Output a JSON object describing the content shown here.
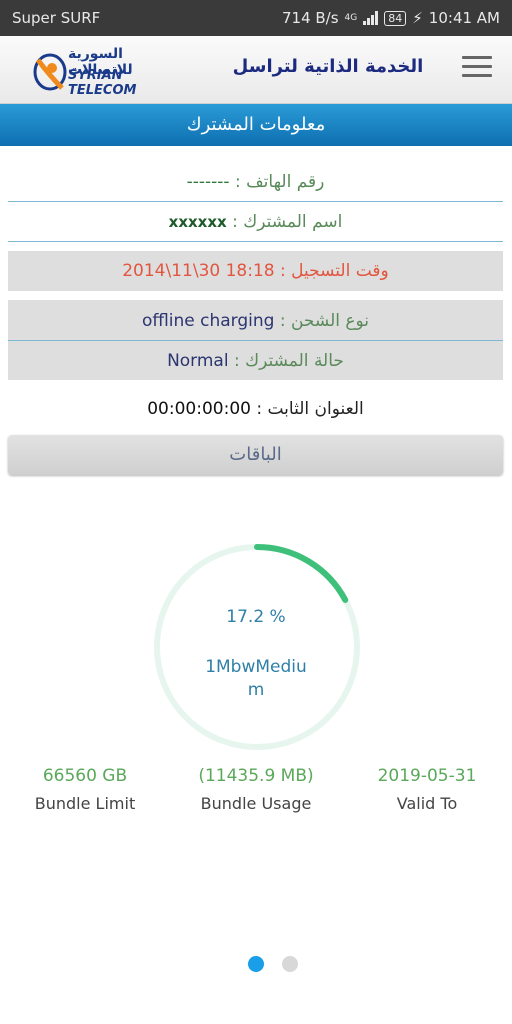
{
  "status_bar": {
    "carrier": "Super SURF",
    "speed": "714 B/s",
    "network": "4G",
    "battery": "84",
    "time": "10:41 AM"
  },
  "app_bar": {
    "logo_arabic": "السورية للاتصالات",
    "logo_english": "SYRIAN TELECOM",
    "title": "الخدمة الذاتية لتراسل"
  },
  "section_title": "معلومات المشترك",
  "subscriber": {
    "phone_label": "رقم الهاتف :",
    "phone_value": "-------",
    "name_label": "اسم المشترك :",
    "name_value": "xxxxxx",
    "reg_label": "وقت التسجيل :",
    "reg_value": "2014\\11\\30 18:18",
    "charge_label": "نوع الشحن :",
    "charge_value": "offline charging",
    "state_label": "حالة المشترك :",
    "state_value": "Normal",
    "ip_label": "العنوان الثابت :",
    "ip_value": "00:00:00:00"
  },
  "packages_button": "الباقات",
  "bundle": {
    "percent_text": "17.2 %",
    "percent": 17.2,
    "name_line1": "1MbwMediu",
    "name_line2": "m",
    "limit_value": "66560 GB",
    "limit_label": "Bundle Limit",
    "usage_value": "(11435.9 MB)",
    "usage_label": "Bundle Usage",
    "valid_value": "2019-05-31",
    "valid_label": "Valid To"
  },
  "pager": {
    "active_index": 0,
    "count": 2
  },
  "colors": {
    "accent_blue": "#1a8fd0",
    "ring_progress": "#3fc07a",
    "ring_track": "#e6f6ef",
    "label_green": "#5a8a5a",
    "reg_red": "#e2563f"
  }
}
